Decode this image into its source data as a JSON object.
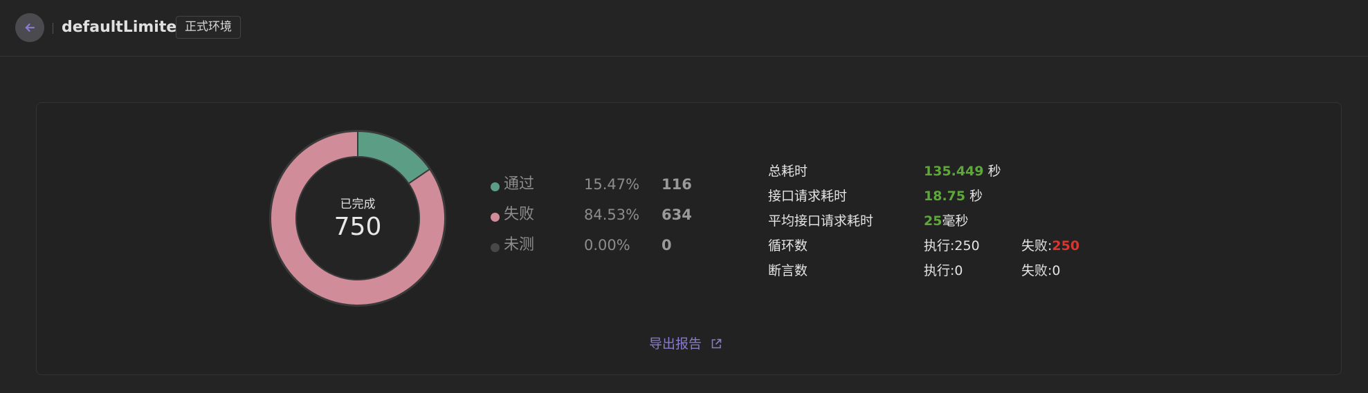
{
  "header": {
    "title": "defaultLimiter",
    "env_badge": "正式环境",
    "back_icon": "arrow-left-icon"
  },
  "summary": {
    "center_label": "已完成",
    "total": "750",
    "legend": [
      {
        "name": "通过",
        "percent": "15.47%",
        "count": "116",
        "color": "#5c9e85"
      },
      {
        "name": "失败",
        "percent": "84.53%",
        "count": "634",
        "color": "#d18c99"
      },
      {
        "name": "未测",
        "percent": "0.00%",
        "count": "0",
        "color": "#484848"
      }
    ]
  },
  "chart_data": {
    "type": "pie",
    "categories": [
      "通过",
      "失败",
      "未测"
    ],
    "values": [
      116,
      634,
      0
    ],
    "colors": [
      "#5c9e85",
      "#d18c99",
      "#484848"
    ],
    "donut": true
  },
  "stats": {
    "total_time": {
      "label": "总耗时",
      "value": "135.449",
      "unit": "秒"
    },
    "api_time": {
      "label": "接口请求耗时",
      "value": "18.75",
      "unit": "秒"
    },
    "avg_time": {
      "label": "平均接口请求耗时",
      "value": "25",
      "unit": "毫秒"
    },
    "loops": {
      "label": "循环数",
      "exec_label": "执行:",
      "exec": "250",
      "fail_label": "失败:",
      "fail": "250"
    },
    "asserts": {
      "label": "断言数",
      "exec_label": "执行:",
      "exec": "0",
      "fail_label": "失败:",
      "fail": "0"
    }
  },
  "export": {
    "label": "导出报告",
    "icon": "external-link-icon"
  },
  "colors": {
    "accent": "#8a7bd0",
    "success": "#5ea83a",
    "danger": "#d8362e"
  }
}
